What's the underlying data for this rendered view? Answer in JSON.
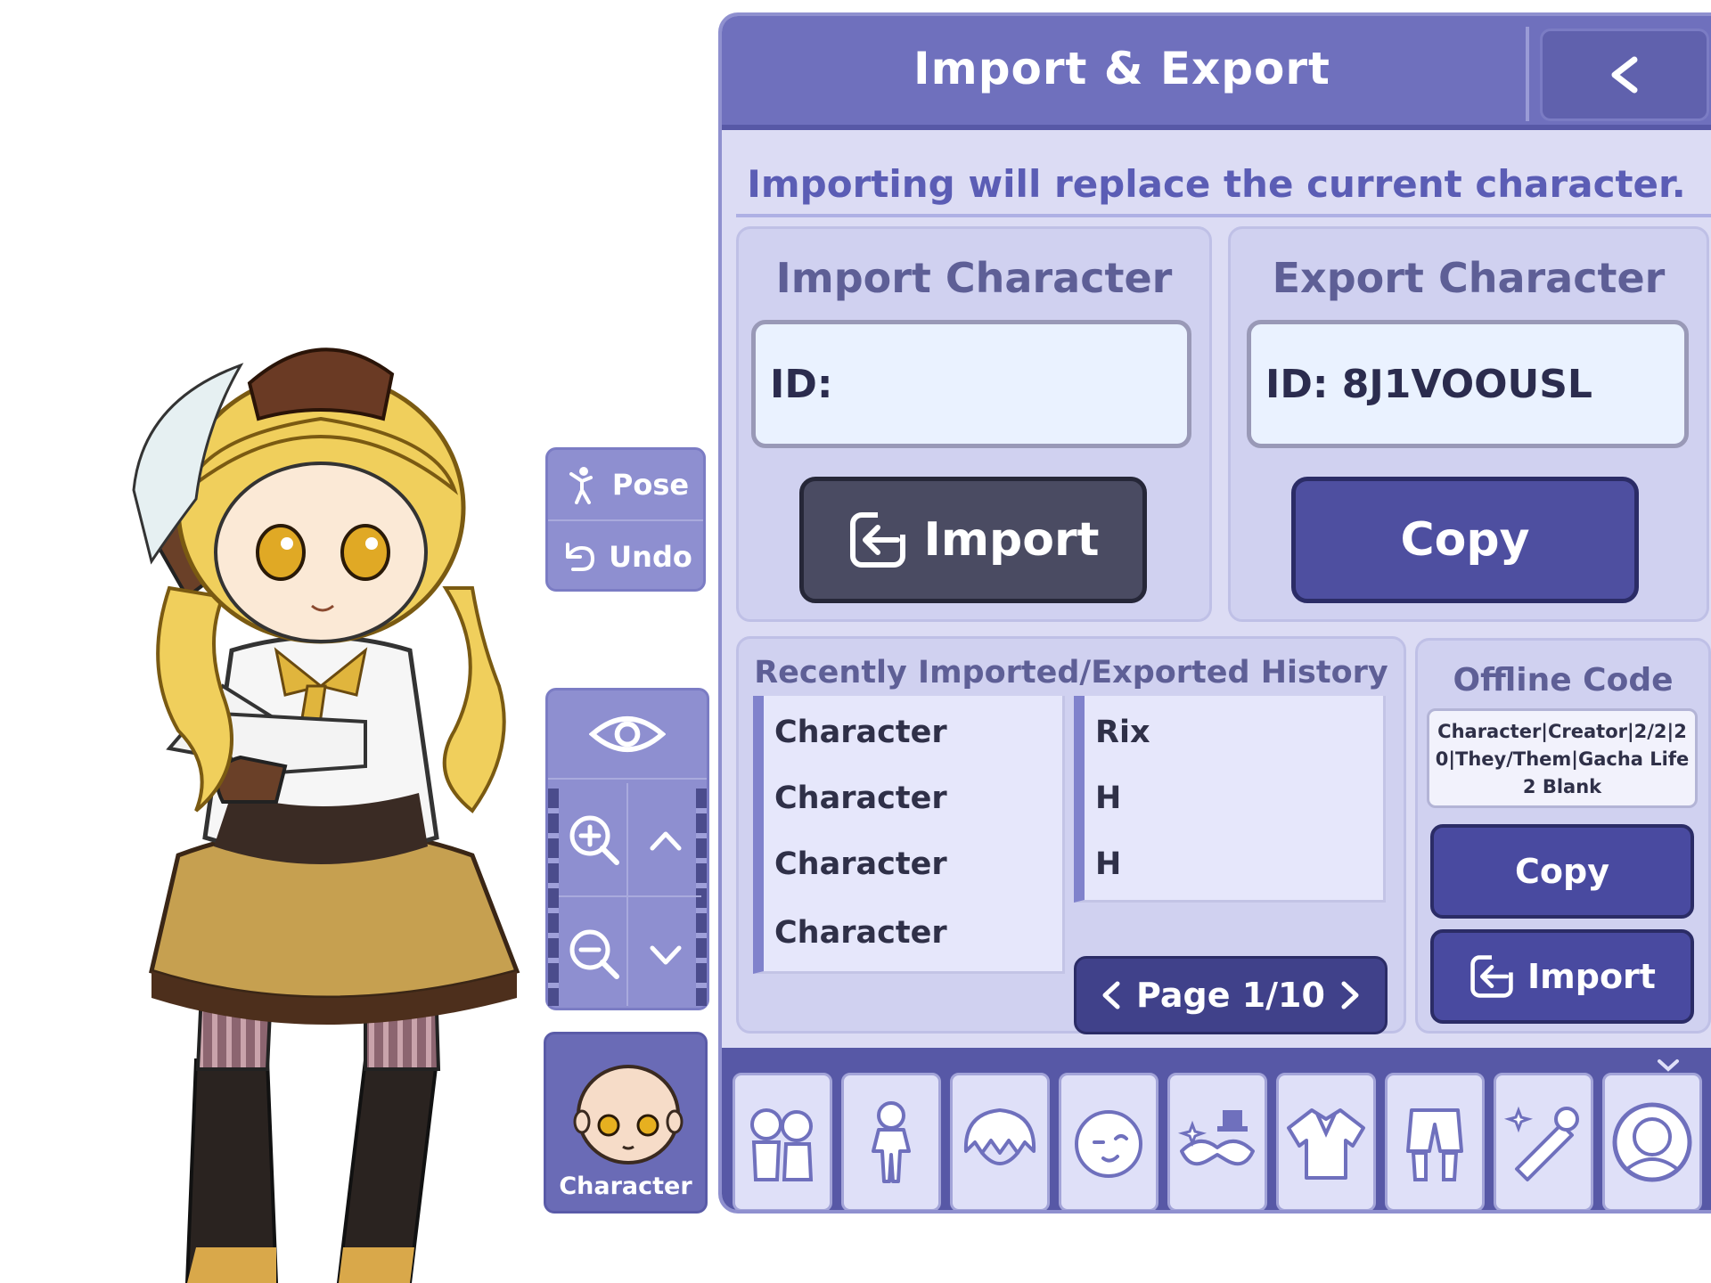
{
  "side_controls": {
    "pose_label": "Pose",
    "undo_label": "Undo",
    "character_tab_label": "Character"
  },
  "panel": {
    "title": "Import & Export",
    "subtitle": "Importing will replace the current character.",
    "import_section": {
      "title": "Import Character",
      "id_value": "ID:",
      "button_label": "Import"
    },
    "export_section": {
      "title": "Export Character",
      "id_value": "ID: 8J1VOOUSL",
      "button_label": "Copy"
    },
    "history": {
      "title": "Recently Imported/Exported History",
      "rows": [
        {
          "name": "Character",
          "value": "Rix"
        },
        {
          "name": "Character",
          "value": "H"
        },
        {
          "name": "Character",
          "value": "H"
        },
        {
          "name": "Character",
          "value": ""
        }
      ],
      "pager_label": "Page 1/10"
    },
    "offline": {
      "title": "Offline Code",
      "code": "Character|Creator|2/2|20|They/Them|Gacha Life 2 Blank",
      "copy_label": "Copy",
      "import_label": "Import"
    }
  },
  "category_tabs": [
    {
      "icon": "presets-icon"
    },
    {
      "icon": "body-icon"
    },
    {
      "icon": "hair-icon"
    },
    {
      "icon": "face-icon"
    },
    {
      "icon": "accessories-icon"
    },
    {
      "icon": "top-clothing-icon"
    },
    {
      "icon": "bottom-clothing-icon"
    },
    {
      "icon": "props-icon"
    },
    {
      "icon": "profile-icon"
    }
  ],
  "colors": {
    "panel_header": "#6f70bd",
    "panel_body": "#dcdcf4",
    "accent_dark": "#40418a",
    "import_button": "#4a4b62",
    "text_accent": "#5b5db5"
  }
}
